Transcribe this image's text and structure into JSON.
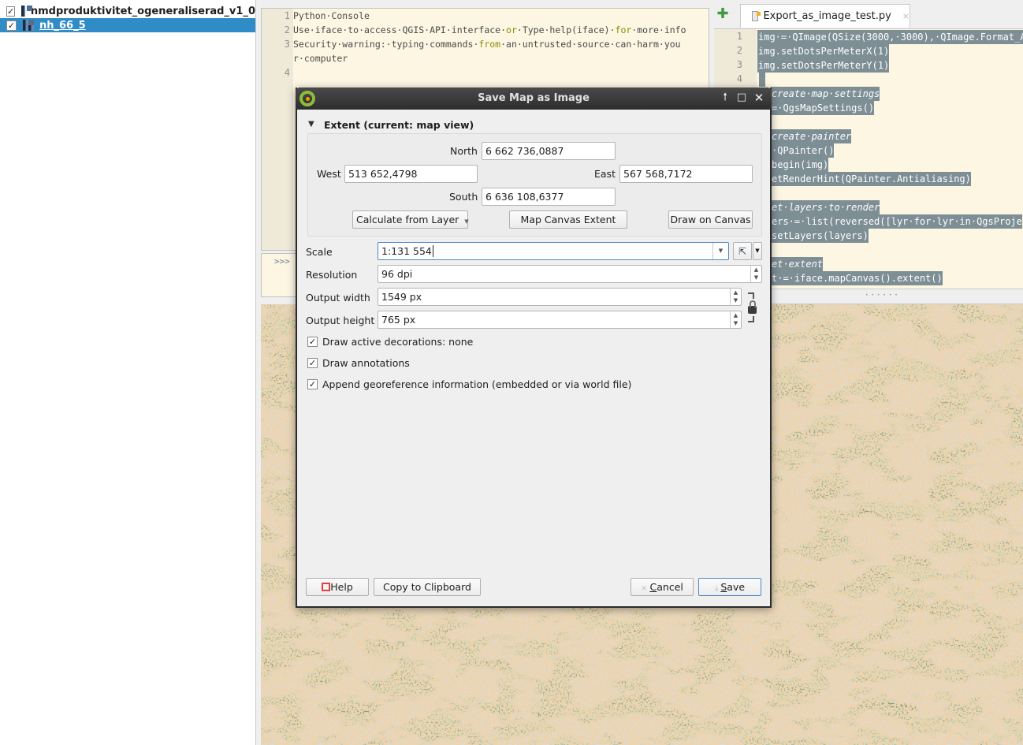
{
  "layers": [
    {
      "name": "nmdproduktivitet_ogeneraliserad_v1_0",
      "checked": true,
      "selected": false
    },
    {
      "name": "nh_66_5",
      "checked": true,
      "selected": true
    }
  ],
  "console": {
    "lines": [
      {
        "num": "1",
        "text": "Python·Console"
      },
      {
        "num": "2",
        "pre": "Use·iface·to·access·QGIS·API·interface·",
        "kw1": "or",
        "mid": "·Type·help(iface)·",
        "kw2": "for",
        "post": "·more·info"
      },
      {
        "num": "3",
        "pre": "Security·warning:·typing·commands·",
        "kw1": "from",
        "post": "·an·untrusted·source·can·harm·you"
      },
      {
        "num": "",
        "text": "r·computer"
      },
      {
        "num": "4",
        "text": ""
      }
    ],
    "prompt": ">>>"
  },
  "editor": {
    "tab_label": "Export_as_image_test.py",
    "tab_close": "×",
    "add_icon": "✚",
    "lines": [
      {
        "num": "1",
        "text": "img·=·QImage(QSize(3000,·3000),·QImage.Format_A",
        "italic": false
      },
      {
        "num": "2",
        "text": "img.setDotsPerMeterX(1)",
        "italic": false
      },
      {
        "num": "3",
        "text": "img.setDotsPerMeterY(1)",
        "italic": false
      },
      {
        "num": "4",
        "text": "",
        "italic": false
      },
      {
        "num": "",
        "text": "create·map·settings",
        "italic": true
      },
      {
        "num": "",
        "text": "=·QgsMapSettings()",
        "italic": false
      },
      {
        "num": "",
        "text": "",
        "italic": false
      },
      {
        "num": "",
        "text": "create·painter",
        "italic": true
      },
      {
        "num": "",
        "text": "·QPainter()",
        "italic": false
      },
      {
        "num": "",
        "text": "begin(img)",
        "italic": false
      },
      {
        "num": "",
        "text": "etRenderHint(QPainter.Antialiasing)",
        "italic": false
      },
      {
        "num": "",
        "text": "",
        "italic": false
      },
      {
        "num": "",
        "text": "et·layers·to·render",
        "italic": true
      },
      {
        "num": "",
        "text": "ers·=·list(reversed([lyr·for·lyr·in·QgsProje",
        "italic": false
      },
      {
        "num": "",
        "text": "setLayers(layers)",
        "italic": false
      },
      {
        "num": "",
        "text": "",
        "italic": false
      },
      {
        "num": "",
        "text": "et·extent",
        "italic": true
      },
      {
        "num": "",
        "text": "t·=·iface.mapCanvas().extent()",
        "italic": false
      }
    ]
  },
  "dialog": {
    "title": "Save Map as Image",
    "title_buttons": {
      "keep_above": "🠕",
      "maximize": "□",
      "close": "✕"
    },
    "extent": {
      "header": "Extent (current: map view)",
      "north_label": "North",
      "north": "6 662 736,0887",
      "west_label": "West",
      "west": "513 652,4798",
      "east_label": "East",
      "east": "567 568,7172",
      "south_label": "South",
      "south": "6 636 108,6377",
      "calc_from_layer": "Calculate from Layer",
      "map_canvas_extent": "Map Canvas Extent",
      "draw_on_canvas": "Draw on Canvas"
    },
    "scale_label": "Scale",
    "scale": "1:131 554",
    "resolution_label": "Resolution",
    "resolution": "96 dpi",
    "width_label": "Output width",
    "width": "1549 px",
    "height_label": "Output height",
    "height": "765 px",
    "checkboxes": [
      {
        "label": "Draw active decorations: none",
        "checked": true
      },
      {
        "label": "Draw annotations",
        "checked": true
      },
      {
        "label": "Append georeference information (embedded or via world file)",
        "checked": true
      }
    ],
    "buttons": {
      "help": "Help",
      "copy": "Copy to Clipboard",
      "cancel_c": "C",
      "cancel_rest": "ancel",
      "save_s": "S",
      "save_rest": "ave"
    }
  },
  "colors": {
    "selection": "#308cc6",
    "console_bg": "#fdf6e3",
    "editor_selection": "#7d8e95",
    "map_green": "#7da27f",
    "map_gray": "#b4b4b4",
    "map_orange": "#d9a86a"
  },
  "checkmark": "✓"
}
